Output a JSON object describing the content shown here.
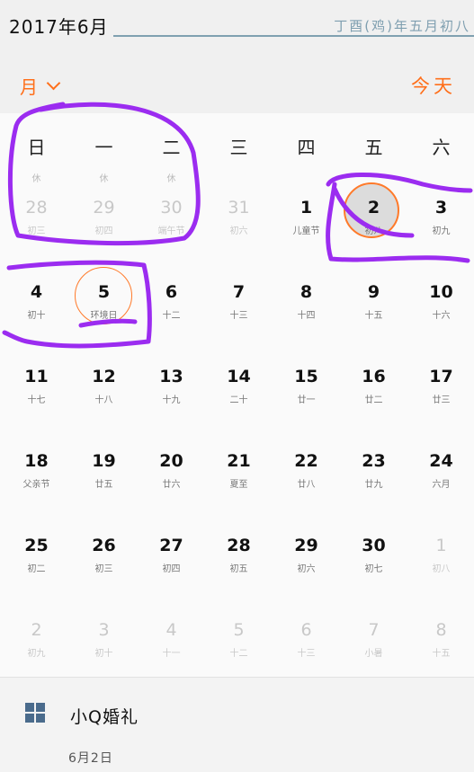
{
  "header": {
    "month_title": "2017年6月",
    "lunar_title": "丁酉(鸡)年五月初八",
    "view_label": "月",
    "today_label": "今天"
  },
  "weekdays": [
    "日",
    "一",
    "二",
    "三",
    "四",
    "五",
    "六"
  ],
  "weekday_sub": [
    "休",
    "休",
    "休",
    "",
    "",
    "",
    ""
  ],
  "weeks": [
    [
      {
        "day": "28",
        "lunar": "初三",
        "faded": true
      },
      {
        "day": "29",
        "lunar": "初四",
        "faded": true
      },
      {
        "day": "30",
        "lunar": "端午节",
        "faded": true
      },
      {
        "day": "31",
        "lunar": "初六",
        "faded": true
      },
      {
        "day": "1",
        "lunar": "儿童节",
        "faded": false
      },
      {
        "day": "2",
        "lunar": "初八",
        "faded": false,
        "selected": true
      },
      {
        "day": "3",
        "lunar": "初九",
        "faded": false
      }
    ],
    [
      {
        "day": "4",
        "lunar": "初十",
        "faded": false
      },
      {
        "day": "5",
        "lunar": "环境日",
        "faded": false,
        "ring": true
      },
      {
        "day": "6",
        "lunar": "十二",
        "faded": false
      },
      {
        "day": "7",
        "lunar": "十三",
        "faded": false
      },
      {
        "day": "8",
        "lunar": "十四",
        "faded": false
      },
      {
        "day": "9",
        "lunar": "十五",
        "faded": false
      },
      {
        "day": "10",
        "lunar": "十六",
        "faded": false
      }
    ],
    [
      {
        "day": "11",
        "lunar": "十七",
        "faded": false
      },
      {
        "day": "12",
        "lunar": "十八",
        "faded": false
      },
      {
        "day": "13",
        "lunar": "十九",
        "faded": false
      },
      {
        "day": "14",
        "lunar": "二十",
        "faded": false
      },
      {
        "day": "15",
        "lunar": "廿一",
        "faded": false
      },
      {
        "day": "16",
        "lunar": "廿二",
        "faded": false
      },
      {
        "day": "17",
        "lunar": "廿三",
        "faded": false
      }
    ],
    [
      {
        "day": "18",
        "lunar": "父亲节",
        "faded": false
      },
      {
        "day": "19",
        "lunar": "廿五",
        "faded": false
      },
      {
        "day": "20",
        "lunar": "廿六",
        "faded": false
      },
      {
        "day": "21",
        "lunar": "夏至",
        "faded": false
      },
      {
        "day": "22",
        "lunar": "廿八",
        "faded": false
      },
      {
        "day": "23",
        "lunar": "廿九",
        "faded": false
      },
      {
        "day": "24",
        "lunar": "六月",
        "faded": false
      }
    ],
    [
      {
        "day": "25",
        "lunar": "初二",
        "faded": false
      },
      {
        "day": "26",
        "lunar": "初三",
        "faded": false
      },
      {
        "day": "27",
        "lunar": "初四",
        "faded": false
      },
      {
        "day": "28",
        "lunar": "初五",
        "faded": false
      },
      {
        "day": "29",
        "lunar": "初六",
        "faded": false
      },
      {
        "day": "30",
        "lunar": "初七",
        "faded": false
      },
      {
        "day": "1",
        "lunar": "初八",
        "faded": true
      }
    ],
    [
      {
        "day": "2",
        "lunar": "初九",
        "faded": true
      },
      {
        "day": "3",
        "lunar": "初十",
        "faded": true
      },
      {
        "day": "4",
        "lunar": "十一",
        "faded": true
      },
      {
        "day": "5",
        "lunar": "十二",
        "faded": true
      },
      {
        "day": "6",
        "lunar": "十三",
        "faded": true
      },
      {
        "day": "7",
        "lunar": "小暑",
        "faded": true
      },
      {
        "day": "8",
        "lunar": "十五",
        "faded": true
      }
    ]
  ],
  "event": {
    "icon": "calendar-grid-icon",
    "title": "小Q婚礼",
    "date": "6月2日"
  },
  "colors": {
    "accent": "#ff6f1a",
    "annotation": "#9b2cf0"
  }
}
